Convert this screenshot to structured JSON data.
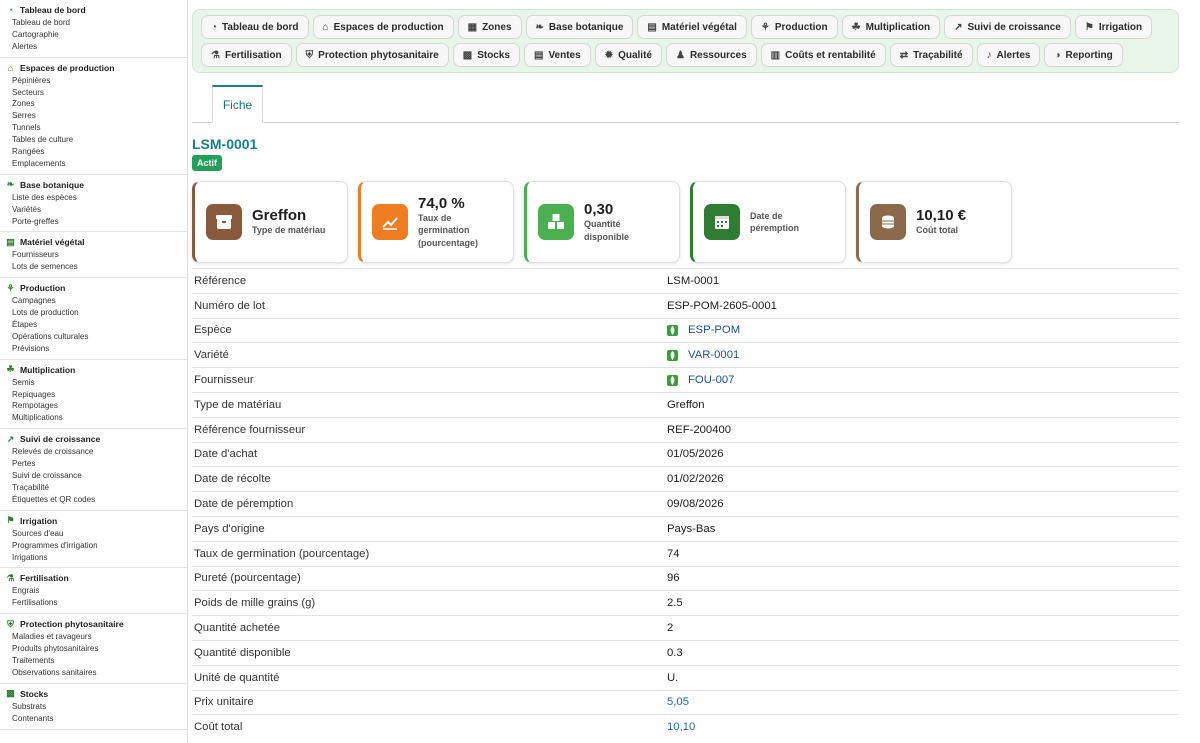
{
  "sidebar": {
    "groups": [
      {
        "title": "Tableau de bord",
        "icon": "dashboard-icon",
        "items": [
          "Tableau de bord",
          "Cartographie",
          "Alertes"
        ]
      },
      {
        "title": "Espaces de production",
        "icon": "greenhouse-icon",
        "items": [
          "Pépinières",
          "Secteurs",
          "Zones",
          "Serres",
          "Tunnels",
          "Tables de culture",
          "Rangées",
          "Emplacements"
        ]
      },
      {
        "title": "Base botanique",
        "icon": "leaf-icon",
        "items": [
          "Liste des espèces",
          "Variétés",
          "Porte-greffes"
        ]
      },
      {
        "title": "Matériel végétal",
        "icon": "box-icon",
        "items": [
          "Fournisseurs",
          "Lots de semences"
        ]
      },
      {
        "title": "Production",
        "icon": "sprout-icon",
        "items": [
          "Campagnes",
          "Lots de production",
          "Étapes",
          "Opérations culturales",
          "Prévisions"
        ]
      },
      {
        "title": "Multiplication",
        "icon": "seedling-icon",
        "items": [
          "Semis",
          "Repiquages",
          "Rempotages",
          "Multiplications"
        ]
      },
      {
        "title": "Suivi de croissance",
        "icon": "chart-icon",
        "items": [
          "Relevés de croissance",
          "Pertes",
          "Suivi de croissance",
          "Traçabilité",
          "Étiquettes et QR codes"
        ]
      },
      {
        "title": "Irrigation",
        "icon": "faucet-icon",
        "items": [
          "Sources d'eau",
          "Programmes d'irrigation",
          "Irrigations"
        ]
      },
      {
        "title": "Fertilisation",
        "icon": "flask-icon",
        "items": [
          "Engrais",
          "Fertilisations"
        ]
      },
      {
        "title": "Protection phytosanitaire",
        "icon": "shield-icon",
        "items": [
          "Maladies et ravageurs",
          "Produits phytosanitaires",
          "Traitements",
          "Observations sanitaires"
        ]
      },
      {
        "title": "Stocks",
        "icon": "stock-icon",
        "items": [
          "Substrats",
          "Contenants"
        ]
      }
    ]
  },
  "topnav": {
    "row1": [
      {
        "label": "Tableau de bord",
        "icon": "dashboard-icon"
      },
      {
        "label": "Espaces de production",
        "icon": "greenhouse-icon"
      },
      {
        "label": "Zones",
        "icon": "map-icon"
      },
      {
        "label": "Base botanique",
        "icon": "leaf-icon"
      },
      {
        "label": "Matériel végétal",
        "icon": "box-icon"
      },
      {
        "label": "Production",
        "icon": "sprout-icon"
      },
      {
        "label": "Multiplication",
        "icon": "seedling-icon"
      },
      {
        "label": "Suivi de croissance",
        "icon": "chart-icon"
      },
      {
        "label": "Irrigation",
        "icon": "faucet-icon"
      }
    ],
    "row2": [
      {
        "label": "Fertilisation",
        "icon": "flask-icon"
      },
      {
        "label": "Protection phytosanitaire",
        "icon": "shield-icon"
      },
      {
        "label": "Stocks",
        "icon": "stock-icon"
      },
      {
        "label": "Ventes",
        "icon": "document-icon"
      },
      {
        "label": "Qualité",
        "icon": "badge-icon"
      },
      {
        "label": "Ressources",
        "icon": "users-icon"
      },
      {
        "label": "Coûts et rentabilité",
        "icon": "money-icon"
      },
      {
        "label": "Traçabilité",
        "icon": "route-icon"
      },
      {
        "label": "Alertes",
        "icon": "bell-icon"
      },
      {
        "label": "Reporting",
        "icon": "pie-icon"
      }
    ]
  },
  "tabs": {
    "fiche": "Fiche"
  },
  "record": {
    "id": "LSM-0001",
    "status": "Actif"
  },
  "cards": [
    {
      "value": "Greffon",
      "label": "Type de matériau",
      "icon": "box-icon",
      "color": "#8a5a3c"
    },
    {
      "value": "74,0 %",
      "label": "Taux de germination (pourcentage)",
      "icon": "trend-up-icon",
      "color": "#ef7d22"
    },
    {
      "value": "0,30",
      "label": "Quantité disponible",
      "icon": "boxes-icon",
      "color": "#4caf50"
    },
    {
      "value": "",
      "label": "Date de péremption",
      "icon": "calendar-icon",
      "color": "#2e7d32"
    },
    {
      "value": "10,10 €",
      "label": "Coût total",
      "icon": "coins-icon",
      "color": "#8a6a4a"
    }
  ],
  "details": [
    {
      "key": "Référence",
      "value": "LSM-0001",
      "type": "text"
    },
    {
      "key": "Numéro de lot",
      "value": "ESP-POM-2605-0001",
      "type": "text"
    },
    {
      "key": "Espèce",
      "value": "ESP-POM",
      "type": "link"
    },
    {
      "key": "Variété",
      "value": "VAR-0001",
      "type": "link"
    },
    {
      "key": "Fournisseur",
      "value": "FOU-007",
      "type": "link"
    },
    {
      "key": "Type de matériau",
      "value": "Greffon",
      "type": "text"
    },
    {
      "key": "Référence fournisseur",
      "value": "REF-200400",
      "type": "text"
    },
    {
      "key": "Date d'achat",
      "value": "01/05/2026",
      "type": "text"
    },
    {
      "key": "Date de récolte",
      "value": "01/02/2026",
      "type": "text"
    },
    {
      "key": "Date de péremption",
      "value": "09/08/2026",
      "type": "text"
    },
    {
      "key": "Pays d'origine",
      "value": "Pays-Bas",
      "type": "text"
    },
    {
      "key": "Taux de germination (pourcentage)",
      "value": "74",
      "type": "text"
    },
    {
      "key": "Pureté (pourcentage)",
      "value": "96",
      "type": "text"
    },
    {
      "key": "Poids de mille grains (g)",
      "value": "2.5",
      "type": "text"
    },
    {
      "key": "Quantité achetée",
      "value": "2",
      "type": "text"
    },
    {
      "key": "Quantité disponible",
      "value": "0.3",
      "type": "text"
    },
    {
      "key": "Unité de quantité",
      "value": "U.",
      "type": "text"
    },
    {
      "key": "Prix unitaire",
      "value": "5,05",
      "type": "num"
    },
    {
      "key": "Coût total",
      "value": "10,10",
      "type": "num"
    }
  ]
}
